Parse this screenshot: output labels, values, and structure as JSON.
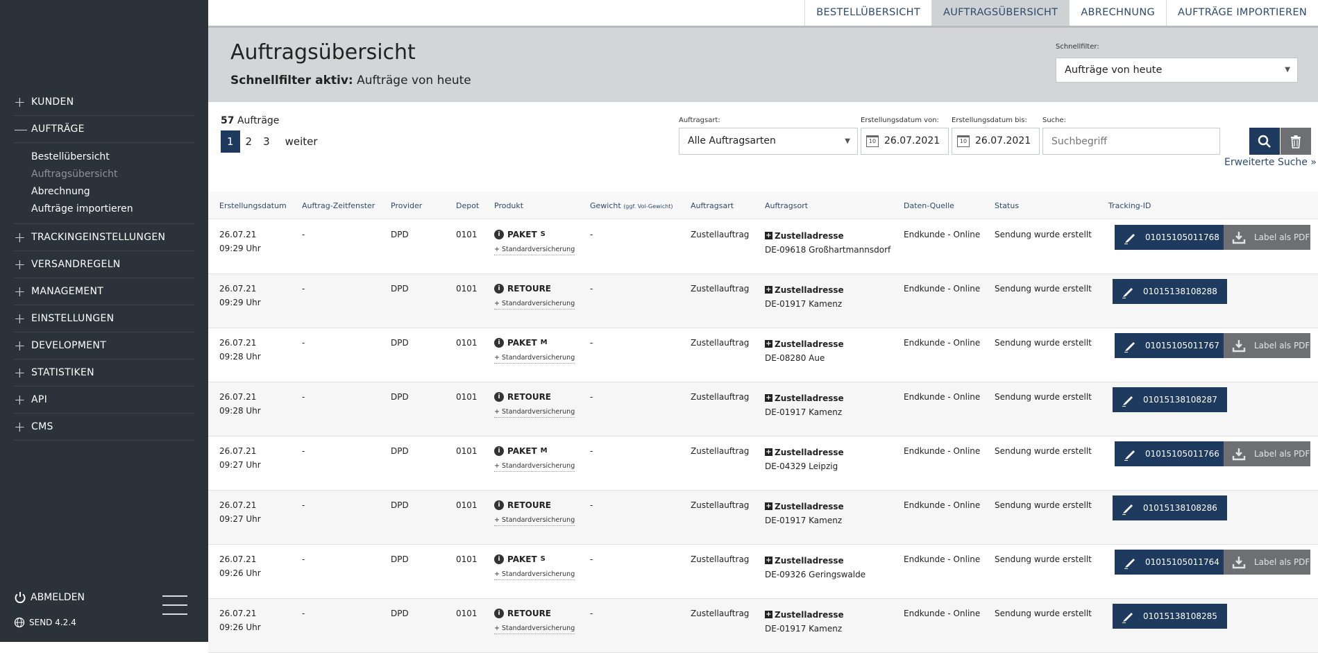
{
  "sidebar": {
    "items": [
      {
        "sym": "+",
        "label": "KUNDEN"
      },
      {
        "sym": "—",
        "label": "AUFTRÄGE"
      },
      {
        "sym": "+",
        "label": "TRACKINGEINSTELLUNGEN"
      },
      {
        "sym": "+",
        "label": "VERSANDREGELN"
      },
      {
        "sym": "+",
        "label": "MANAGEMENT"
      },
      {
        "sym": "+",
        "label": "EINSTELLUNGEN"
      },
      {
        "sym": "+",
        "label": "DEVELOPMENT"
      },
      {
        "sym": "+",
        "label": "STATISTIKEN"
      },
      {
        "sym": "+",
        "label": "API"
      },
      {
        "sym": "+",
        "label": "CMS"
      }
    ],
    "subitems": [
      "Bestellübersicht",
      "Auftragsübersicht",
      "Abrechnung",
      "Aufträge importieren"
    ],
    "logout": "ABMELDEN",
    "version": "SEND 4.2.4"
  },
  "topnav": [
    "BESTELLÜBERSICHT",
    "AUFTRAGSÜBERSICHT",
    "ABRECHNUNG",
    "AUFTRÄGE IMPORTIEREN"
  ],
  "header": {
    "title": "Auftragsübersicht",
    "quickfilter_prefix": "Schnellfilter aktiv:",
    "quickfilter_value": "Aufträge von heute",
    "schnellfilter_label": "Schnellfilter:",
    "schnellfilter_value": "Aufträge von heute"
  },
  "list": {
    "count": "57",
    "count_label": "Aufträge",
    "pages": [
      "1",
      "2",
      "3"
    ],
    "next": "weiter"
  },
  "filters": {
    "auftragsart_label": "Auftragsart:",
    "auftragsart_value": "Alle Auftragsarten",
    "von_label": "Erstellungsdatum von:",
    "von_value": "26.07.2021",
    "bis_label": "Erstellungsdatum bis:",
    "bis_value": "26.07.2021",
    "suche_label": "Suche:",
    "suche_placeholder": "Suchbegriff",
    "calendar_day": "10",
    "advanced": "Erweiterte Suche »"
  },
  "columns": {
    "erstellungsdatum": "Erstellungsdatum",
    "zeitfenster": "Auftrag-Zeitfenster",
    "provider": "Provider",
    "depot": "Depot",
    "produkt": "Produkt",
    "gewicht": "Gewicht",
    "gewicht_note": "(ggf. Vol-Gewicht)",
    "auftragsart": "Auftragsart",
    "auftragsort": "Auftragsort",
    "quelle": "Daten-Quelle",
    "status": "Status",
    "tracking": "Tracking-ID"
  },
  "rows": [
    {
      "date": "26.07.21",
      "time": "09:29 Uhr",
      "window": "-",
      "provider": "DPD",
      "depot": "0101",
      "product": "PAKET",
      "size": "S",
      "insurance": "+ Standardversicherung",
      "weight": "-",
      "type": "Zustellauftrag",
      "place_label": "Zustelladresse",
      "place": "DE-09618 Großhartmannsdorf",
      "source": "Endkunde - Online",
      "status": "Sendung wurde erstellt",
      "tracking": "01015105011768",
      "pdf": "Label als PDF"
    },
    {
      "date": "26.07.21",
      "time": "09:29 Uhr",
      "window": "-",
      "provider": "DPD",
      "depot": "0101",
      "product": "RETOURE",
      "size": "",
      "insurance": "+ Standardversicherung",
      "weight": "-",
      "type": "Zustellauftrag",
      "place_label": "Zustelladresse",
      "place": "DE-01917 Kamenz",
      "source": "Endkunde - Online",
      "status": "Sendung wurde erstellt",
      "tracking": "01015138108288",
      "pdf": ""
    },
    {
      "date": "26.07.21",
      "time": "09:28 Uhr",
      "window": "-",
      "provider": "DPD",
      "depot": "0101",
      "product": "PAKET",
      "size": "M",
      "insurance": "+ Standardversicherung",
      "weight": "-",
      "type": "Zustellauftrag",
      "place_label": "Zustelladresse",
      "place": "DE-08280 Aue",
      "source": "Endkunde - Online",
      "status": "Sendung wurde erstellt",
      "tracking": "01015105011767",
      "pdf": "Label als PDF"
    },
    {
      "date": "26.07.21",
      "time": "09:28 Uhr",
      "window": "-",
      "provider": "DPD",
      "depot": "0101",
      "product": "RETOURE",
      "size": "",
      "insurance": "+ Standardversicherung",
      "weight": "-",
      "type": "Zustellauftrag",
      "place_label": "Zustelladresse",
      "place": "DE-01917 Kamenz",
      "source": "Endkunde - Online",
      "status": "Sendung wurde erstellt",
      "tracking": "01015138108287",
      "pdf": ""
    },
    {
      "date": "26.07.21",
      "time": "09:27 Uhr",
      "window": "-",
      "provider": "DPD",
      "depot": "0101",
      "product": "PAKET",
      "size": "M",
      "insurance": "+ Standardversicherung",
      "weight": "-",
      "type": "Zustellauftrag",
      "place_label": "Zustelladresse",
      "place": "DE-04329 Leipzig",
      "source": "Endkunde - Online",
      "status": "Sendung wurde erstellt",
      "tracking": "01015105011766",
      "pdf": "Label als PDF"
    },
    {
      "date": "26.07.21",
      "time": "09:27 Uhr",
      "window": "-",
      "provider": "DPD",
      "depot": "0101",
      "product": "RETOURE",
      "size": "",
      "insurance": "+ Standardversicherung",
      "weight": "-",
      "type": "Zustellauftrag",
      "place_label": "Zustelladresse",
      "place": "DE-01917 Kamenz",
      "source": "Endkunde - Online",
      "status": "Sendung wurde erstellt",
      "tracking": "01015138108286",
      "pdf": ""
    },
    {
      "date": "26.07.21",
      "time": "09:26 Uhr",
      "window": "-",
      "provider": "DPD",
      "depot": "0101",
      "product": "PAKET",
      "size": "S",
      "insurance": "+ Standardversicherung",
      "weight": "-",
      "type": "Zustellauftrag",
      "place_label": "Zustelladresse",
      "place": "DE-09326 Geringswalde",
      "source": "Endkunde - Online",
      "status": "Sendung wurde erstellt",
      "tracking": "01015105011764",
      "pdf": "Label als PDF"
    },
    {
      "date": "26.07.21",
      "time": "09:26 Uhr",
      "window": "-",
      "provider": "DPD",
      "depot": "0101",
      "product": "RETOURE",
      "size": "",
      "insurance": "+ Standardversicherung",
      "weight": "-",
      "type": "Zustellauftrag",
      "place_label": "Zustelladresse",
      "place": "DE-01917 Kamenz",
      "source": "Endkunde - Online",
      "status": "Sendung wurde erstellt",
      "tracking": "01015138108285",
      "pdf": ""
    }
  ]
}
